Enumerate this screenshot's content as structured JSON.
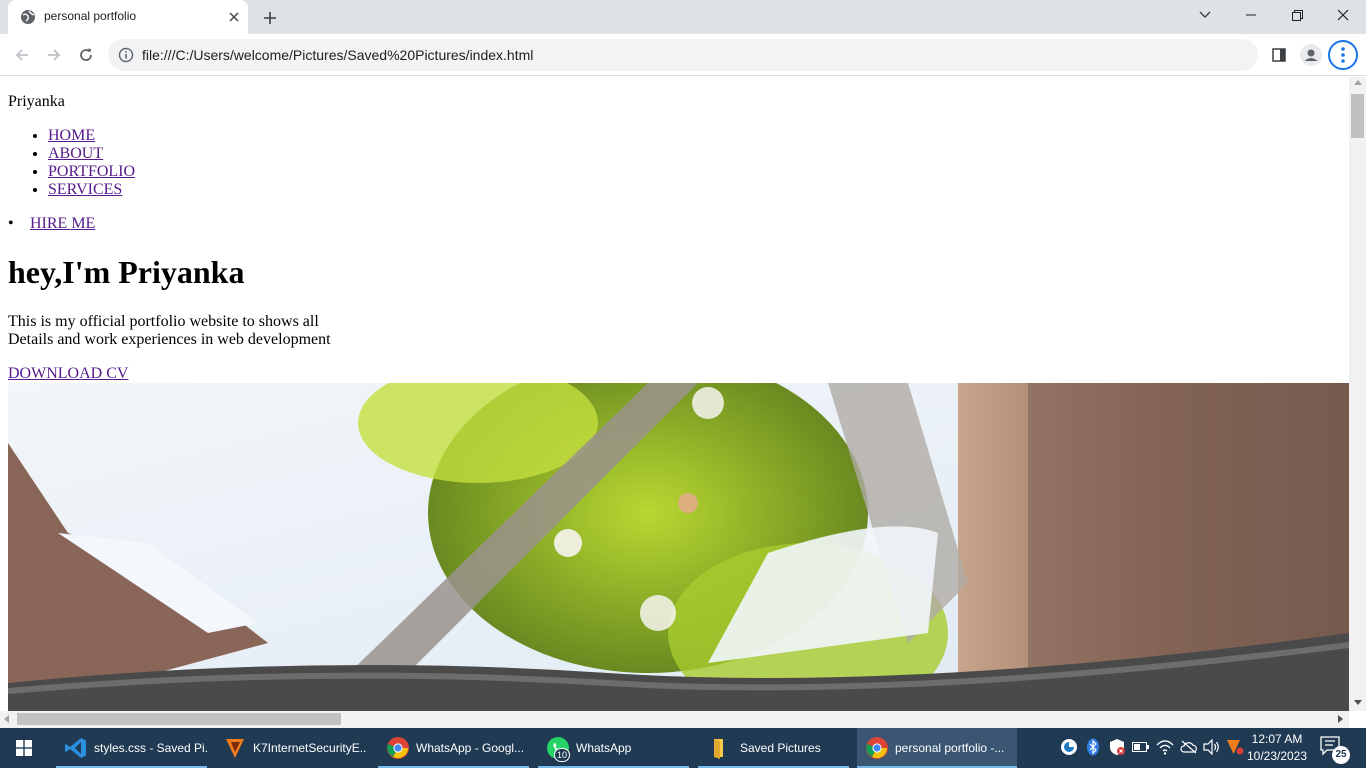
{
  "browser": {
    "tab_title": "personal portfolio",
    "url": "file:///C:/Users/welcome/Pictures/Saved%20Pictures/index.html"
  },
  "page": {
    "brand": "Priyanka",
    "nav": [
      {
        "label": "HOME"
      },
      {
        "label": "ABOUT"
      },
      {
        "label": "PORTFOLIO"
      },
      {
        "label": "SERVICES"
      }
    ],
    "hire_me": "HIRE ME",
    "headline": "hey,I'm Priyanka",
    "intro_line1": "This is my official portfolio website to shows all",
    "intro_line2": "Details and work experiences in web development",
    "download_cv": "DOWNLOAD CV"
  },
  "taskbar": {
    "items": [
      {
        "label": "styles.css - Saved Pi...",
        "icon": "vscode-icon"
      },
      {
        "label": "K7InternetSecurityE...",
        "icon": "k7-icon"
      },
      {
        "label": "WhatsApp - Googl...",
        "icon": "chrome-icon"
      },
      {
        "label": "WhatsApp",
        "icon": "whatsapp-icon",
        "badge": "10"
      },
      {
        "label": "Saved Pictures",
        "icon": "folder-icon"
      },
      {
        "label": "personal portfolio -...",
        "icon": "chrome-icon"
      }
    ],
    "time": "12:07 AM",
    "date": "10/23/2023",
    "notification_count": "25"
  },
  "colors": {
    "link_visited": "#551a8b",
    "taskbar_bg": "#1f3a52",
    "tabstrip_bg": "#dee1e6",
    "accent": "#1a73e8"
  }
}
